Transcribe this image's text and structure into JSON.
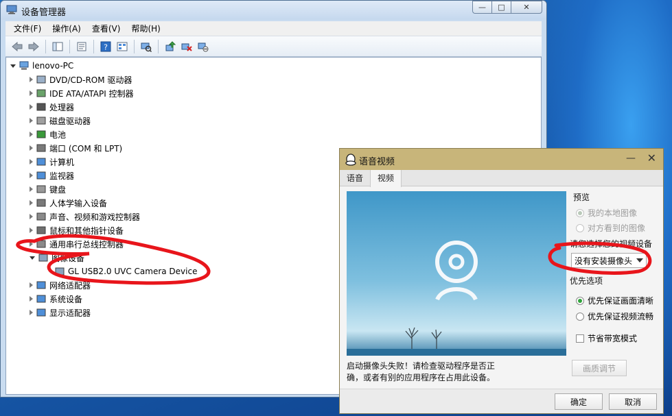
{
  "device_manager": {
    "title": "设备管理器",
    "window_buttons": {
      "minimize": "—",
      "maximize": "□",
      "close": "✕"
    },
    "menu": [
      "文件(F)",
      "操作(A)",
      "查看(V)",
      "帮助(H)"
    ],
    "toolbar_icons": [
      "back-icon",
      "forward-icon",
      "show-hide-tree-icon",
      "properties-icon",
      "help-icon",
      "view-icon",
      "scan-hardware-icon",
      "update-driver-icon",
      "uninstall-icon",
      "disable-icon"
    ],
    "tree": {
      "root": "lenovo-PC",
      "items": [
        {
          "label": "DVD/CD-ROM 驱动器",
          "icon": "dvd-drive-icon"
        },
        {
          "label": "IDE ATA/ATAPI 控制器",
          "icon": "ide-controller-icon"
        },
        {
          "label": "处理器",
          "icon": "processor-icon"
        },
        {
          "label": "磁盘驱动器",
          "icon": "disk-drive-icon"
        },
        {
          "label": "电池",
          "icon": "battery-icon"
        },
        {
          "label": "端口 (COM 和 LPT)",
          "icon": "port-icon"
        },
        {
          "label": "计算机",
          "icon": "computer-icon"
        },
        {
          "label": "监视器",
          "icon": "monitor-icon"
        },
        {
          "label": "键盘",
          "icon": "keyboard-icon"
        },
        {
          "label": "人体学输入设备",
          "icon": "hid-icon"
        },
        {
          "label": "声音、视频和游戏控制器",
          "icon": "sound-icon"
        },
        {
          "label": "鼠标和其他指针设备",
          "icon": "mouse-icon"
        },
        {
          "label": "通用串行总线控制器",
          "icon": "usb-icon"
        },
        {
          "label": "图像设备",
          "icon": "imaging-device-icon"
        },
        {
          "label": "GL USB2.0 UVC Camera Device",
          "icon": "camera-icon"
        },
        {
          "label": "网络适配器",
          "icon": "network-adapter-icon"
        },
        {
          "label": "系统设备",
          "icon": "system-device-icon"
        },
        {
          "label": "显示适配器",
          "icon": "display-adapter-icon"
        }
      ]
    }
  },
  "qq_dialog": {
    "title": "语音视频",
    "tabs": [
      "语音",
      "视频"
    ],
    "active_tab": "视频",
    "preview": {
      "section_label": "预览",
      "options": [
        "我的本地图像",
        "对方看到的图像"
      ],
      "selected": "我的本地图像"
    },
    "device": {
      "label": "请您选择您的视频设备",
      "selected": "没有安装摄像头"
    },
    "priority": {
      "label": "优先选项",
      "options": [
        "优先保证画面清晰",
        "优先保证视频流畅"
      ],
      "selected": "优先保证画面清晰"
    },
    "bandwidth_saving": "节省带宽模式",
    "quality_button": "画质调节",
    "error_message": "启动摄像头失败！请检查驱动程序是否正确，或者有别的应用程序在占用此设备。",
    "ok_button": "确定",
    "cancel_button": "取消",
    "close_glyph": "✕",
    "minimize_glyph": "—"
  },
  "colors": {
    "annotation": "#e8151b",
    "qq_titlebar": "#c8b57a",
    "radio_checked": "#2fa33b"
  }
}
